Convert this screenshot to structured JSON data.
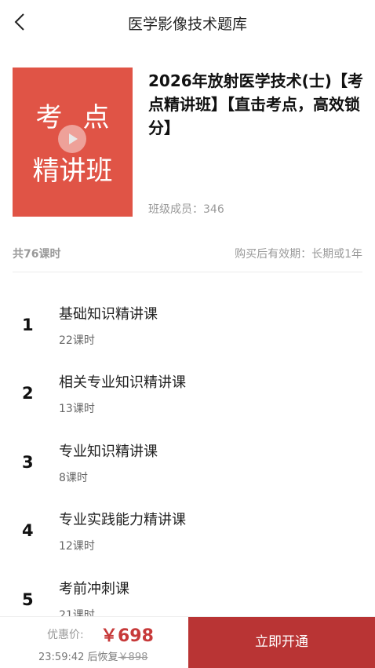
{
  "nav": {
    "title": "医学影像技术题库",
    "back_icon": "chevron-left-icon"
  },
  "course": {
    "cover_line1": "考点",
    "cover_line2": "精讲班",
    "cover_color": "#e05446",
    "play_icon": "play-icon",
    "title": "2026年放射医学技术(士)【考点精讲班】【直击考点，高效锁分】",
    "members_label": "班级成员：",
    "members_count": "346"
  },
  "summary": {
    "total_lessons": "共76课时",
    "validity": "购买后有效期：长期或1年"
  },
  "lessons": [
    {
      "num": "1",
      "name": "基础知识精讲课",
      "count": "22课时"
    },
    {
      "num": "2",
      "name": "相关专业知识精讲课",
      "count": "13课时"
    },
    {
      "num": "3",
      "name": "专业知识精讲课",
      "count": "8课时"
    },
    {
      "num": "4",
      "name": "专业实践能力精讲课",
      "count": "12课时"
    },
    {
      "num": "5",
      "name": "考前冲刺课",
      "count": "21课时"
    }
  ],
  "purchase": {
    "price_label": "优惠价:",
    "price": "￥698",
    "countdown": "23:59:42",
    "restore_text": "后恢复",
    "original_price": "￥898",
    "buy_label": "立即开通",
    "accent_color": "#b93434"
  }
}
